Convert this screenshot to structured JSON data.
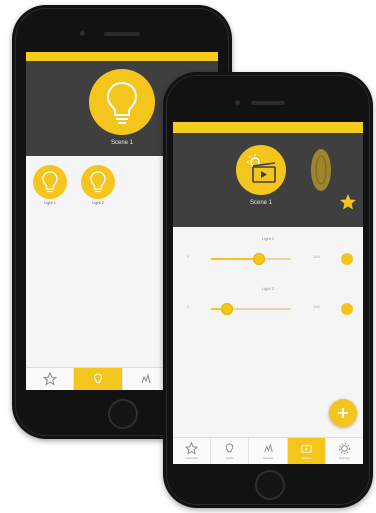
{
  "back_phone": {
    "scene_title": "Scene 1",
    "lights": [
      {
        "label": "Light 1"
      },
      {
        "label": "Light 2"
      }
    ],
    "nav": [
      {
        "icon": "star-icon",
        "active": false
      },
      {
        "icon": "bulb-icon",
        "active": true
      },
      {
        "icon": "scene-icon",
        "active": false
      },
      {
        "icon": "star-icon",
        "active": false
      }
    ]
  },
  "front_phone": {
    "scene_title": "Scene 1",
    "secondary_label": "",
    "favorite_icon": "star-icon",
    "sliders": [
      {
        "label": "Light 1",
        "level": 0.6,
        "min_label": "0",
        "max_label": "100"
      },
      {
        "label": "Light 2",
        "level": 0.2,
        "min_label": "0",
        "max_label": "100"
      }
    ],
    "fab_icon": "plus-icon",
    "nav": [
      {
        "icon": "star-icon",
        "label": "Favorites",
        "active": false
      },
      {
        "icon": "bulb-icon",
        "label": "Lights",
        "active": false
      },
      {
        "icon": "scene-icon",
        "label": "Scenes",
        "active": false
      },
      {
        "icon": "film-icon",
        "label": "Scenes",
        "active": true
      },
      {
        "icon": "settings-icon",
        "label": "Settings",
        "active": false
      }
    ]
  },
  "colors": {
    "accent": "#f4c51c",
    "header": "#3f3f3f",
    "frame": "#121212"
  }
}
